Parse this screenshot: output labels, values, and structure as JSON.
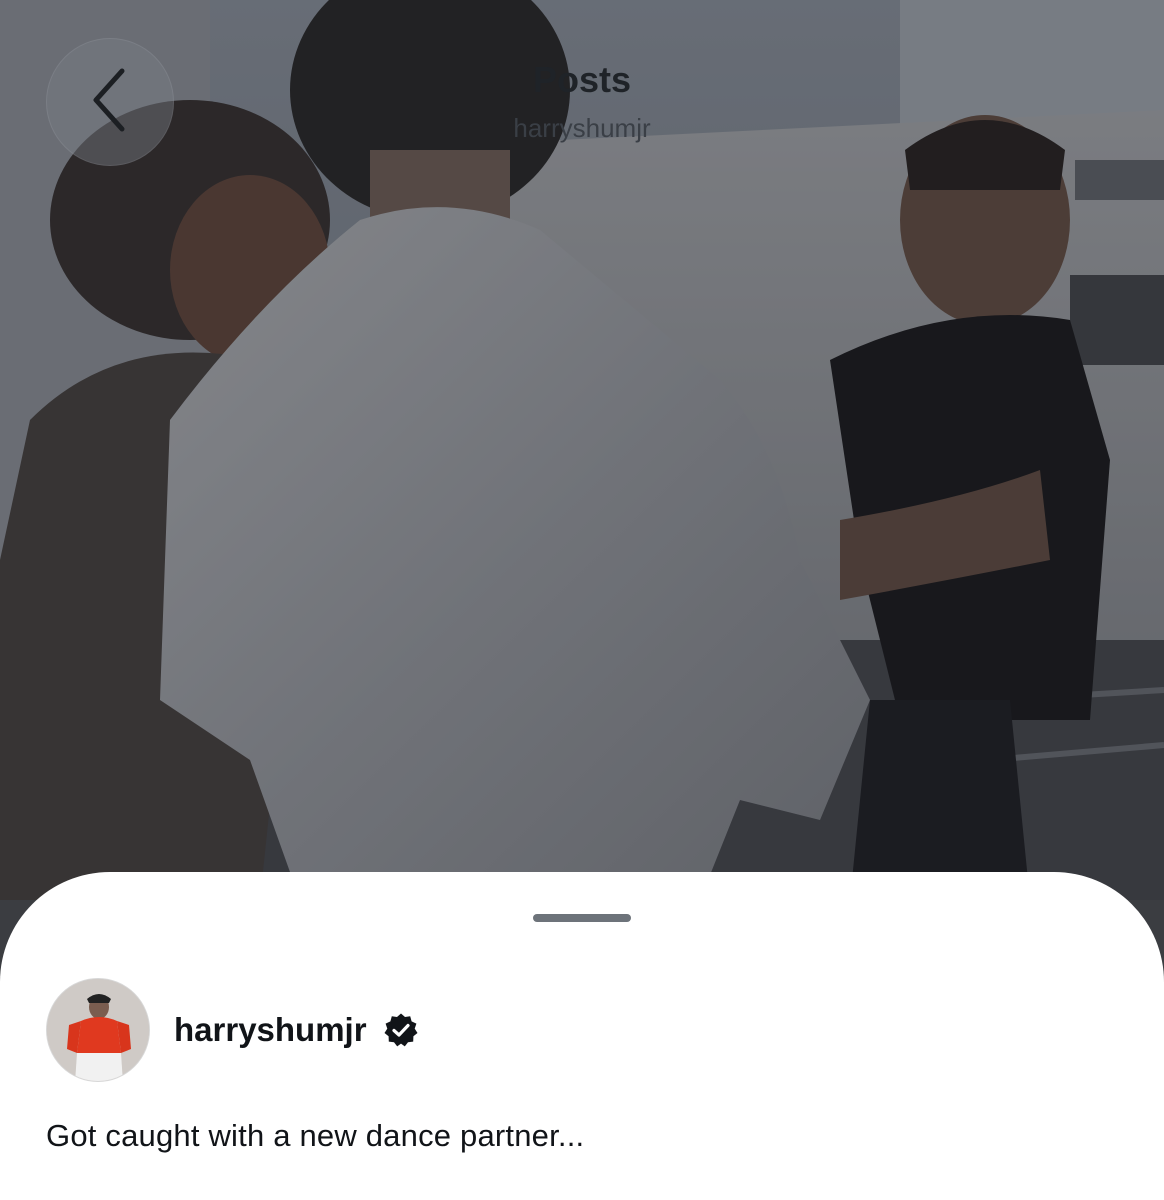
{
  "header": {
    "title": "Posts",
    "subtitle": "harryshumjr",
    "back_icon": "chevron-left-icon"
  },
  "post": {
    "username": "harryshumjr",
    "verified_icon": "verified-badge-icon",
    "caption": "Got caught with a new dance partner..."
  },
  "colors": {
    "sheet_background": "#ffffff",
    "handle": "#6d737a",
    "text_primary": "#111418",
    "photo_dim": "#3b3d41"
  }
}
